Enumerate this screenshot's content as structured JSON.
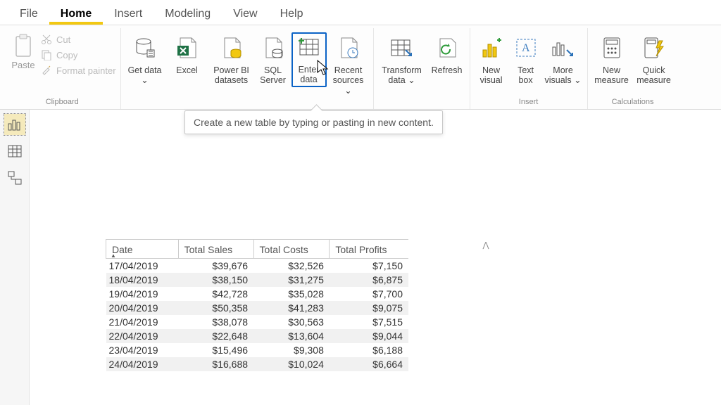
{
  "tabs": [
    "File",
    "Home",
    "Insert",
    "Modeling",
    "View",
    "Help"
  ],
  "active_tab": "Home",
  "ribbon": {
    "clipboard": {
      "label": "Clipboard",
      "paste": "Paste",
      "cut": "Cut",
      "copy": "Copy",
      "format_painter": "Format painter"
    },
    "data": {
      "get_data": "Get data ⌄",
      "excel": "Excel",
      "pbi_datasets": "Power BI datasets",
      "sql_server": "SQL Server",
      "enter_data": "Enter data",
      "recent": "Recent sources ⌄"
    },
    "queries": {
      "transform": "Transform data ⌄",
      "refresh": "Refresh"
    },
    "insert": {
      "label": "Insert",
      "new_visual": "New visual",
      "text_box": "Text box",
      "more_visuals": "More visuals ⌄"
    },
    "calculations": {
      "label": "Calculations",
      "new_measure": "New measure",
      "quick_measure": "Quick measure"
    }
  },
  "tooltip_text": "Create a new table by typing or pasting in new content.",
  "view_tabs": [
    "report",
    "data",
    "model"
  ],
  "chart_data": {
    "type": "table",
    "columns": [
      "Date",
      "Total Sales",
      "Total Costs",
      "Total Profits"
    ],
    "rows": [
      [
        "17/04/2019",
        "$39,676",
        "$32,526",
        "$7,150"
      ],
      [
        "18/04/2019",
        "$38,150",
        "$31,275",
        "$6,875"
      ],
      [
        "19/04/2019",
        "$42,728",
        "$35,028",
        "$7,700"
      ],
      [
        "20/04/2019",
        "$50,358",
        "$41,283",
        "$9,075"
      ],
      [
        "21/04/2019",
        "$38,078",
        "$30,563",
        "$7,515"
      ],
      [
        "22/04/2019",
        "$22,648",
        "$13,604",
        "$9,044"
      ],
      [
        "23/04/2019",
        "$15,496",
        "$9,308",
        "$6,188"
      ],
      [
        "24/04/2019",
        "$16,688",
        "$10,024",
        "$6,664"
      ]
    ]
  }
}
